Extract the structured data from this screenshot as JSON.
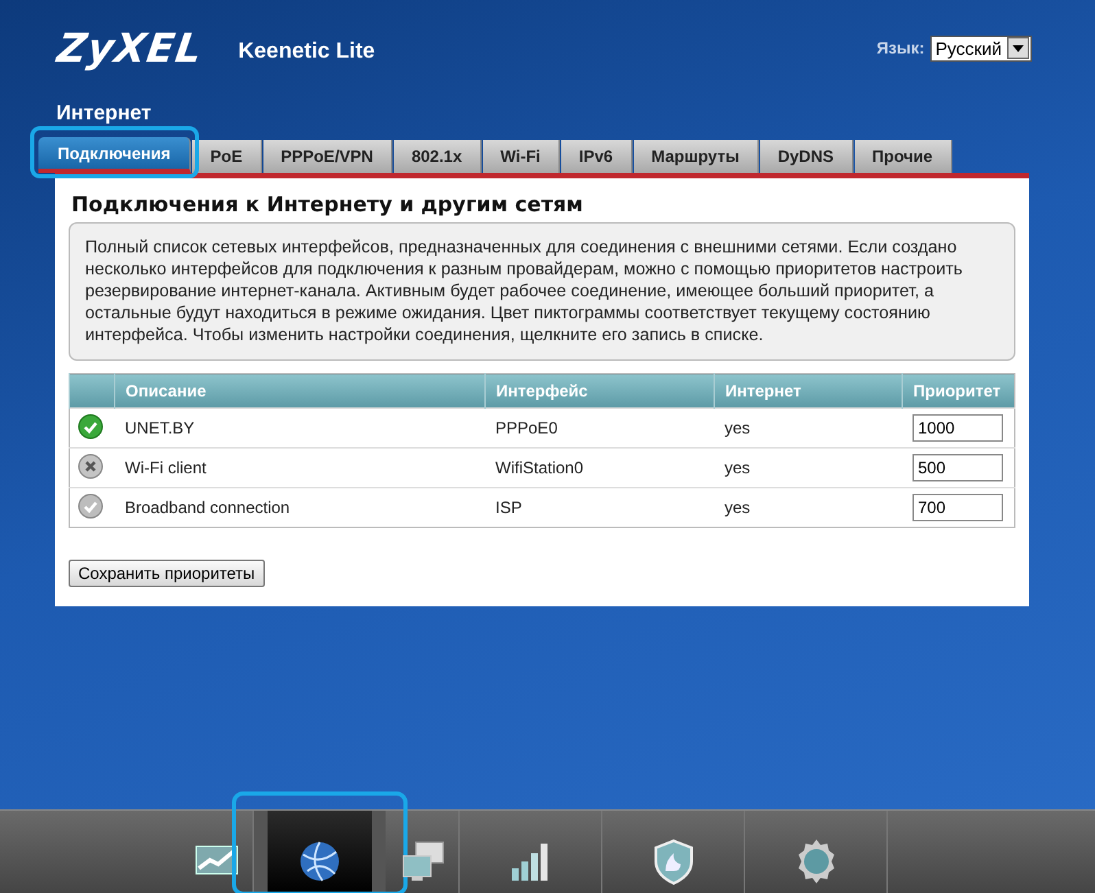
{
  "header": {
    "logo": "ZyXEL",
    "model": "Keenetic Lite",
    "language_label": "Язык:",
    "language": "Русский"
  },
  "section_title": "Интернет",
  "tabs": [
    {
      "label": "Подключения",
      "selected": true,
      "highlighted": true
    },
    {
      "label": "PoE",
      "selected": false,
      "highlighted": false
    },
    {
      "label": "PPPoE/VPN",
      "selected": false,
      "highlighted": false
    },
    {
      "label": "802.1x",
      "selected": false,
      "highlighted": false
    },
    {
      "label": "Wi-Fi",
      "selected": false,
      "highlighted": false
    },
    {
      "label": "IPv6",
      "selected": false,
      "highlighted": false
    },
    {
      "label": "Маршруты",
      "selected": false,
      "highlighted": false
    },
    {
      "label": "DyDNS",
      "selected": false,
      "highlighted": false
    },
    {
      "label": "Прочие",
      "selected": false,
      "highlighted": false
    }
  ],
  "panel": {
    "title": "Подключения к Интернету и другим сетям",
    "description": "Полный список сетевых интерфейсов, предназначенных для соединения с внешними сетями. Если создано несколько интерфейсов для подключения к разным провайдерам, можно с помощью приоритетов настроить резервирование интернет-канала. Активным будет рабочее соединение, имеющее больший приоритет, а остальные будут находиться в режиме ожидания. Цвет пиктограммы соответствует текущему состоянию интерфейса. Чтобы изменить настройки соединения, щелкните его запись в списке.",
    "table": {
      "columns": [
        "Описание",
        "Интерфейс",
        "Интернет",
        "Приоритет"
      ],
      "rows": [
        {
          "kind": "ok",
          "description": "UNET.BY",
          "interface": "PPPoE0",
          "internet": "yes",
          "priority": "1000"
        },
        {
          "kind": "error",
          "description": "Wi-Fi client",
          "interface": "WifiStation0",
          "internet": "yes",
          "priority": "500"
        },
        {
          "kind": "idle",
          "description": "Broadband connection",
          "interface": "ISP",
          "internet": "yes",
          "priority": "700"
        }
      ]
    },
    "save_button": "Сохранить приоритеты"
  },
  "taskbar": [
    {
      "kind": "monitor",
      "selected": false,
      "highlighted": false
    },
    {
      "kind": "globe",
      "selected": true,
      "highlighted": true
    },
    {
      "kind": "computers",
      "selected": false,
      "highlighted": false
    },
    {
      "kind": "signal",
      "selected": false,
      "highlighted": false
    },
    {
      "kind": "shield",
      "selected": false,
      "highlighted": false
    },
    {
      "kind": "gear",
      "selected": false,
      "highlighted": false
    }
  ]
}
